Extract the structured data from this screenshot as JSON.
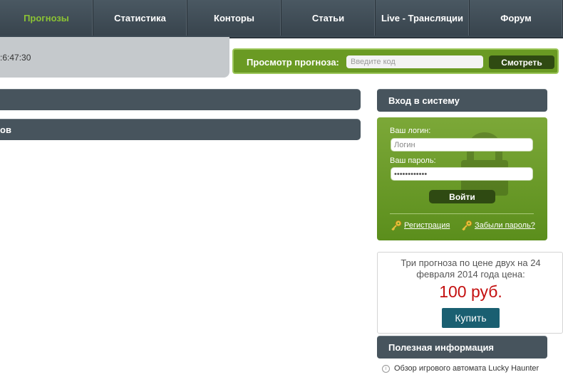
{
  "nav": {
    "items": [
      {
        "label": "Прогнозы",
        "width": 131
      },
      {
        "label": "Статистика",
        "width": 132
      },
      {
        "label": "Конторы",
        "width": 132
      },
      {
        "label": "Статьи",
        "width": 132
      },
      {
        "label": "Live - Трансляции",
        "width": 132
      },
      {
        "label": "Форум",
        "width": 131
      }
    ],
    "active_index": 0,
    "active_color": "#8bc234"
  },
  "clock": ":6:47:30",
  "viewer": {
    "label": "Просмотр прогноза:",
    "placeholder": "Введите код",
    "button": "Смотреть"
  },
  "left_bars": [
    "",
    "ов"
  ],
  "login": {
    "header": "Вход в систему",
    "login_label": "Ваш логин:",
    "login_placeholder": "Логин",
    "password_label": "Ваш пароль:",
    "password_value": "••••••••••••",
    "button": "Войти",
    "register_link": "Регистрация",
    "forgot_link": "Забыли пароль?"
  },
  "promo": {
    "text": "Три прогноза по цене двух на 24 февраля 2014 года цена:",
    "price": "100 руб.",
    "button": "Купить",
    "price_color": "#c41010"
  },
  "info": {
    "header": "Полезная информация",
    "items": [
      "Обзор игрового автомата Lucky Haunter"
    ]
  },
  "colors": {
    "nav_bg": "#3d4a54",
    "green_accent": "#6a9a23",
    "dark_button": "#2f4a12",
    "buy_button": "#1a5f71"
  }
}
